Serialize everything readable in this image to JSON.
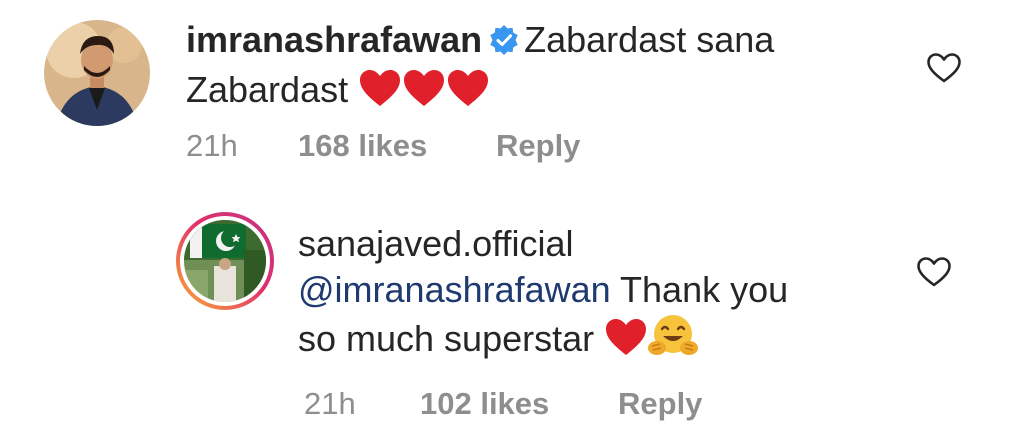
{
  "comments": [
    {
      "username": "imranashrafawan",
      "verified": true,
      "text_line1": "Zabardast sana",
      "text_line2": "Zabardast",
      "hearts": 3,
      "time": "21h",
      "likes": "168 likes",
      "reply": "Reply",
      "avatar_icon": "profile-photo-man-in-blazer",
      "like_icon": "heart-outline-icon"
    },
    {
      "username": "sanajaved.official",
      "mention": "@imranashrafawan",
      "text_line1_rest": "Thank you",
      "text_line2": "so much superstar",
      "time": "21h",
      "likes": "102 likes",
      "reply": "Reply",
      "avatar_icon": "profile-photo-with-story-ring",
      "like_icon": "heart-outline-icon"
    }
  ],
  "colors": {
    "text": "#262626",
    "meta": "#8e8e8e",
    "mention": "#1e3a6e",
    "verified": "#3897f0",
    "heart": "#e0202a"
  }
}
